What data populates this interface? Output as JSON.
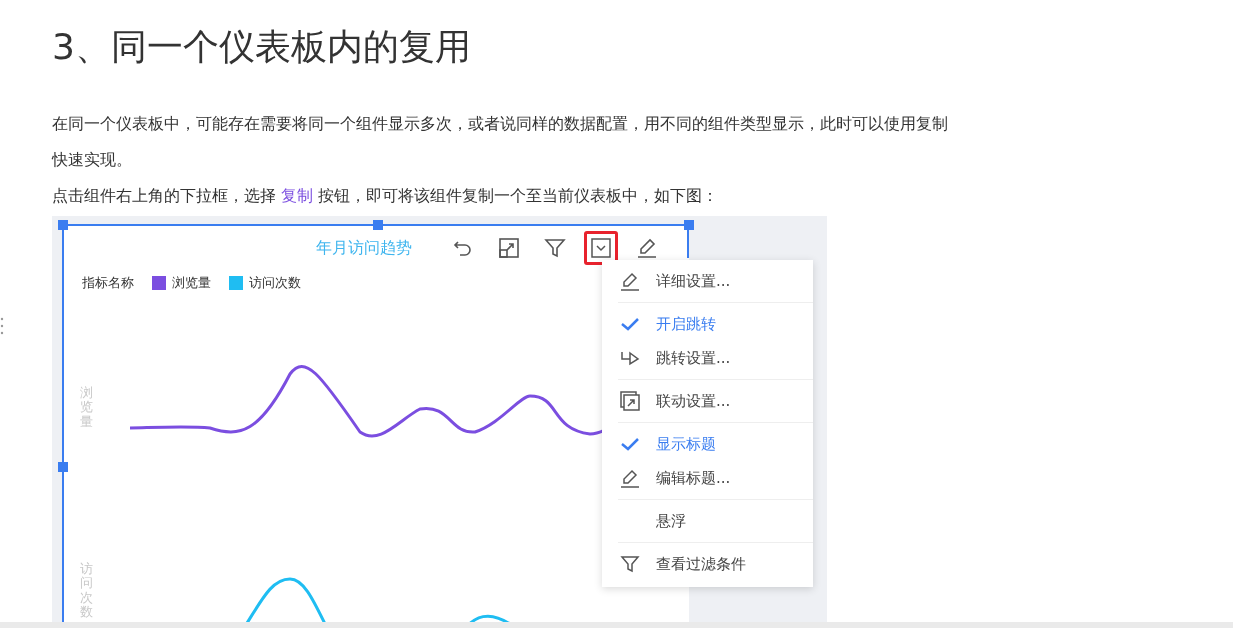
{
  "heading": "3、同一个仪表板内的复用",
  "paragraph_1": {
    "lines": [
      "在同一个仪表板中，可能存在需要将同一个组件显示多次，或者说同样的数据配置，用不同的组件类型显示，此时可以使用复制",
      "快速实现。"
    ]
  },
  "paragraph_2": {
    "before": "点击组件右上角的下拉框，选择 ",
    "link": "复制",
    "after": " 按钮，即可将该组件复制一个至当前仪表板中，如下图："
  },
  "widget": {
    "title": "年月访问趋势",
    "legend": {
      "label": "指标名称",
      "items": [
        {
          "name": "浏览量",
          "color": "#7b4ee0"
        },
        {
          "name": "访问次数",
          "color": "#1fbdf2"
        }
      ]
    },
    "axis_labels": [
      "浏览量",
      "访问次数"
    ],
    "menu_groups": [
      {
        "items": [
          {
            "kind": "edit",
            "label": "详细设置..."
          }
        ]
      },
      {
        "items": [
          {
            "kind": "toggle",
            "label": "开启跳转",
            "checked": true
          },
          {
            "kind": "jump",
            "label": "跳转设置..."
          }
        ]
      },
      {
        "items": [
          {
            "kind": "link",
            "label": "联动设置..."
          }
        ]
      },
      {
        "items": [
          {
            "kind": "toggle",
            "label": "显示标题",
            "checked": true
          },
          {
            "kind": "edit",
            "label": "编辑标题..."
          }
        ]
      },
      {
        "items": [
          {
            "kind": "plain",
            "label": "悬浮"
          }
        ]
      },
      {
        "items": [
          {
            "kind": "filter",
            "label": "查看过滤条件"
          }
        ]
      }
    ]
  }
}
